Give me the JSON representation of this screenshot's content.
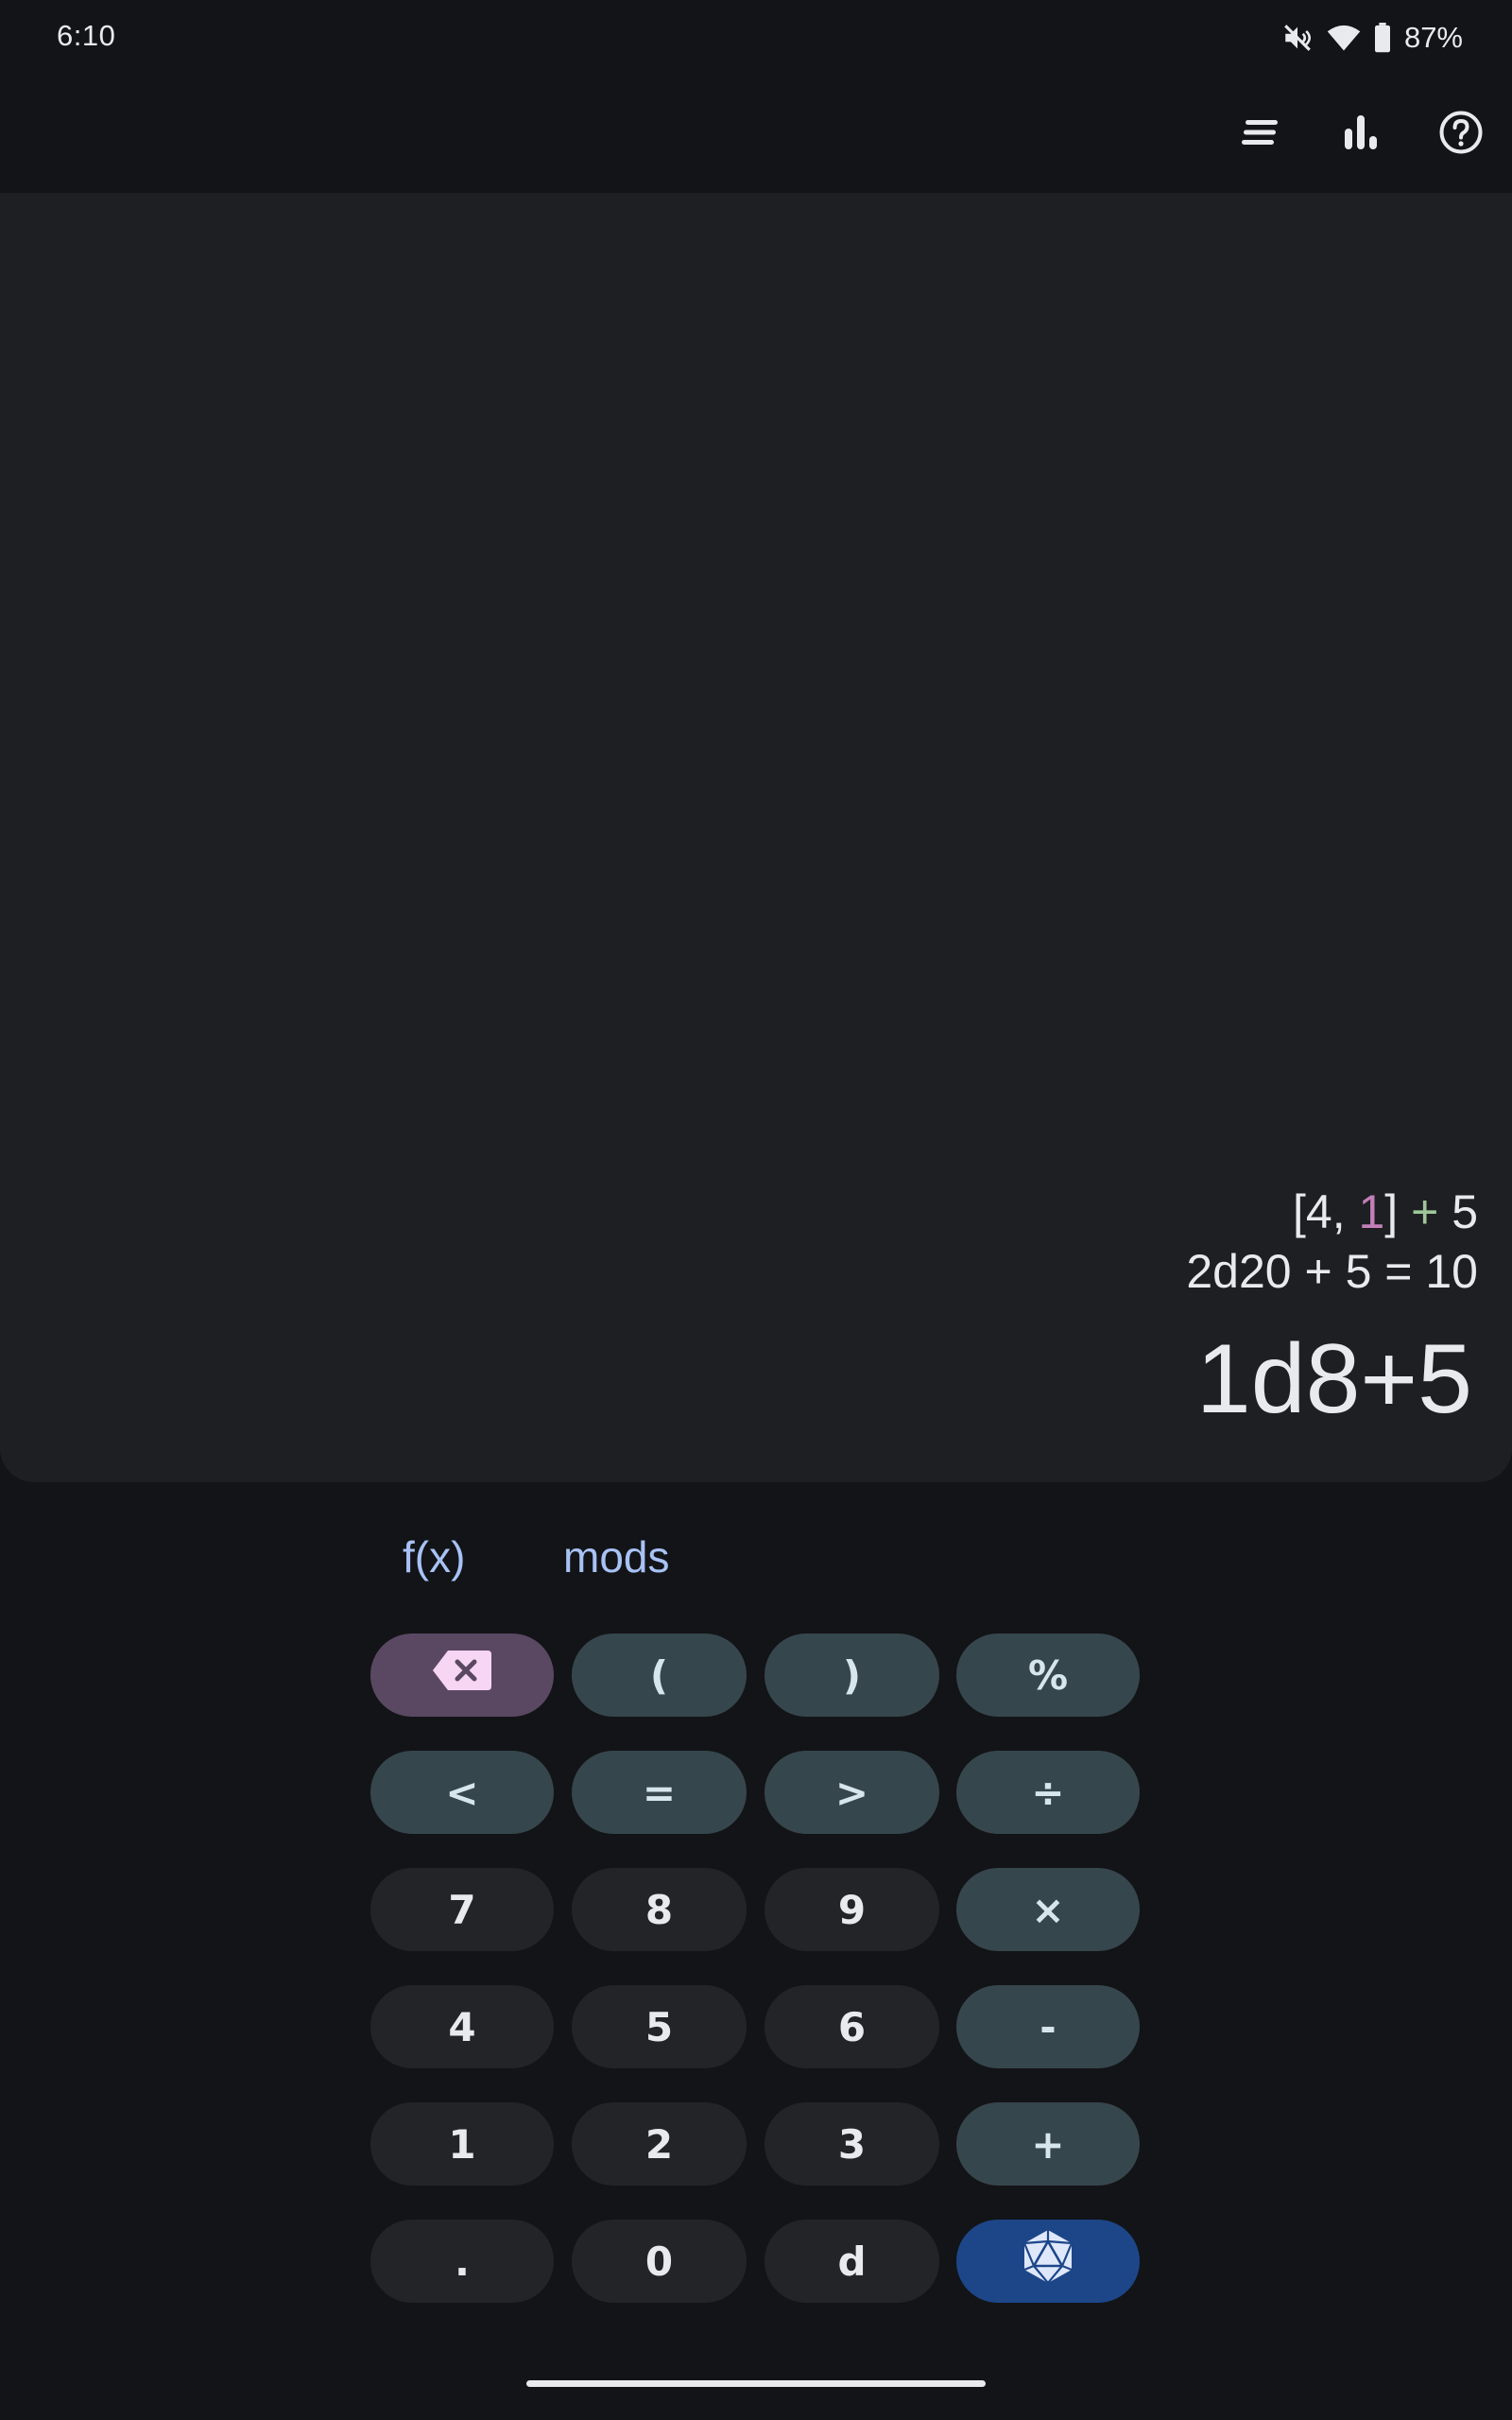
{
  "status_bar": {
    "time": "6:10",
    "battery_percent": "87%",
    "icons": [
      "mute-icon",
      "wifi-icon",
      "battery-icon"
    ]
  },
  "toolbar": {
    "icons": [
      "history-icon",
      "stats-icon",
      "help-icon"
    ]
  },
  "display": {
    "detail_parts": [
      "[4, ",
      "1",
      "]",
      " + ",
      "5"
    ],
    "previous_result": "2d20 + 5 = 10",
    "expression": "1d8+5"
  },
  "tabs": [
    "f(x)",
    "mods"
  ],
  "keys": {
    "row1": [
      "(",
      ")",
      "%"
    ],
    "row2": [
      "<",
      "=",
      ">",
      "÷"
    ],
    "row3": [
      "7",
      "8",
      "9",
      "×"
    ],
    "row4": [
      "4",
      "5",
      "6",
      "-"
    ],
    "row5": [
      "1",
      "2",
      "3",
      "+"
    ],
    "row6": [
      ".",
      "0",
      "d"
    ]
  },
  "colors": {
    "background": "#131417",
    "display_background": "#1e1f23",
    "number_key": "#232428",
    "operator_key": "#36464d",
    "backspace_key": "#5a4862",
    "roll_key": "#1d4689",
    "tab_text": "#a8c2f5",
    "dropped_die": "#c27fb8",
    "modifier_plus": "#9fc69a"
  }
}
